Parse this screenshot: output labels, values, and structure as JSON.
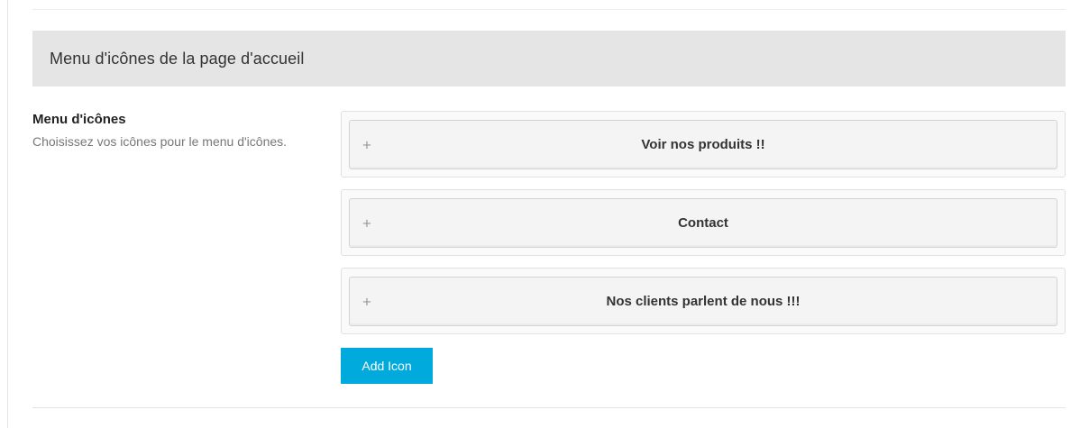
{
  "section": {
    "title": "Menu d'icônes de la page d'accueil"
  },
  "field": {
    "label": "Menu d'icônes",
    "description": "Choisissez vos icônes pour le menu d'icônes."
  },
  "items": [
    {
      "title": "Voir nos produits !!",
      "icon": "+"
    },
    {
      "title": "Contact",
      "icon": "+"
    },
    {
      "title": "Nos clients parlent de nous !!!",
      "icon": "+"
    }
  ],
  "actions": {
    "add_label": "Add Icon"
  },
  "colors": {
    "header_bg": "#e5e5e5",
    "button_bg": "#00aadd",
    "button_text": "#ffffff"
  }
}
